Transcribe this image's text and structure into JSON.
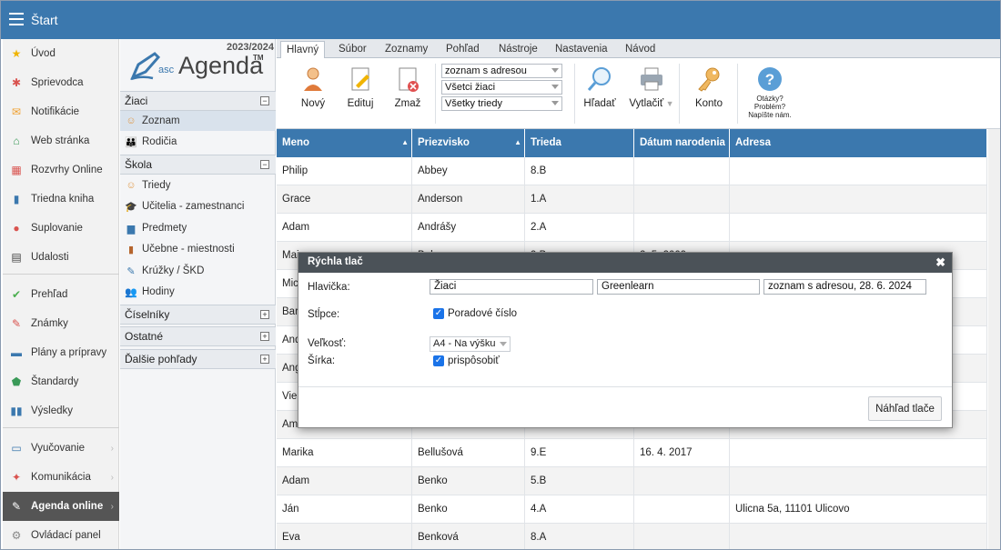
{
  "topbar": {
    "title": "Štart"
  },
  "leftnav": {
    "items": [
      {
        "label": "Úvod",
        "icon": "star-icon",
        "color": "#f0b400"
      },
      {
        "label": "Sprievodca",
        "icon": "wand-icon",
        "color": "#d9534f"
      },
      {
        "label": "Notifikácie",
        "icon": "envelope-icon",
        "color": "#f0a030"
      },
      {
        "label": "Web stránka",
        "icon": "house-icon",
        "color": "#3a9a58"
      },
      {
        "label": "Rozvrhy Online",
        "icon": "timetable-icon",
        "color": "#d9534f"
      },
      {
        "label": "Triedna kniha",
        "icon": "book-icon",
        "color": "#3b78ae"
      },
      {
        "label": "Suplovanie",
        "icon": "person-icon",
        "color": "#d9534f"
      },
      {
        "label": "Udalosti",
        "icon": "calendar-icon",
        "color": "#444"
      },
      {
        "label": "Prehľad",
        "icon": "check-circle-icon",
        "color": "#4caf50"
      },
      {
        "label": "Známky",
        "icon": "grade-icon",
        "color": "#d9534f"
      },
      {
        "label": "Plány a prípravy",
        "icon": "briefcase-icon",
        "color": "#3b78ae"
      },
      {
        "label": "Štandardy",
        "icon": "shield-icon",
        "color": "#3a9a58"
      },
      {
        "label": "Výsledky",
        "icon": "bar-chart-icon",
        "color": "#3b78ae"
      },
      {
        "label": "Vyučovanie",
        "icon": "open-book-icon",
        "color": "#3b78ae"
      },
      {
        "label": "Komunikácia",
        "icon": "chat-icon",
        "color": "#d9534f"
      },
      {
        "label": "Agenda online",
        "icon": "agenda-pen-icon",
        "color": "#ffffff"
      },
      {
        "label": "Ovládací panel",
        "icon": "gear-icon",
        "color": "#888"
      }
    ]
  },
  "logo": {
    "year": "2023/2024",
    "asc": "asc",
    "name": "Agenda",
    "tm": "TM"
  },
  "tree": {
    "sec_ziaci": "Žiaci",
    "zoznam": "Zoznam",
    "rodicia": "Rodičia",
    "sec_skola": "Škola",
    "triedy": "Triedy",
    "ucitelia": "Učitelia - zamestnanci",
    "predmety": "Predmety",
    "ucebne": "Učebne - miestnosti",
    "kruzky": "Krúžky / ŠKD",
    "hodiny": "Hodiny",
    "sec_ciselniky": "Číselníky",
    "sec_ostatne": "Ostatné",
    "sec_dalsie": "Ďalšie pohľady",
    "collapse_sym": "−",
    "expand_sym": "+"
  },
  "tabs": [
    "Hlavný",
    "Súbor",
    "Zoznamy",
    "Pohľad",
    "Nástroje",
    "Nastavenia",
    "Návod"
  ],
  "ribbon": {
    "novy": "Nový",
    "edituj": "Edituj",
    "zmaz": "Zmaž",
    "select1": "zoznam s adresou",
    "select2": "Všetci žiaci",
    "select3": "Všetky triedy",
    "hladat": "Hľadať",
    "vytlacit": "Vytlačiť",
    "konto": "Konto",
    "help_line1": "Otázky?",
    "help_line2": "Problém?",
    "help_line3": "Napíšte nám."
  },
  "grid": {
    "headers": [
      "Meno",
      "Priezvisko",
      "Trieda",
      "Dátum narodenia",
      "Adresa"
    ],
    "sort_arrow": "▲",
    "rows": [
      [
        "Philip",
        "Abbey",
        "8.B",
        "",
        ""
      ],
      [
        "Grace",
        "Anderson",
        "1.A",
        "",
        ""
      ],
      [
        "Adam",
        "Andrášy",
        "2.A",
        "",
        ""
      ],
      [
        "Mai",
        "Bel",
        "9.B",
        "2. 5. 2009",
        ""
      ],
      [
        "Mic",
        "",
        "",
        "",
        ""
      ],
      [
        "Bar",
        "",
        "",
        "",
        ""
      ],
      [
        "And",
        "",
        "",
        "",
        ""
      ],
      [
        "Ang",
        "",
        "",
        "",
        ""
      ],
      [
        "Vie",
        "",
        "",
        "",
        ""
      ],
      [
        "Am",
        "",
        "",
        "",
        ""
      ],
      [
        "Marika",
        "Bellušová",
        "9.E",
        "16. 4. 2017",
        ""
      ],
      [
        "Adam",
        "Benko",
        "5.B",
        "",
        ""
      ],
      [
        "Ján",
        "Benko",
        "4.A",
        "",
        "Ulicna 5a, 11101 Ulicovo"
      ],
      [
        "Eva",
        "Benková",
        "8.A",
        "",
        ""
      ]
    ]
  },
  "dialog": {
    "title": "Rýchla tlač",
    "close": "✖",
    "hlavicka_label": "Hlavička:",
    "hlavicka_1": "Žiaci",
    "hlavicka_2": "Greenlearn",
    "hlavicka_3": "zoznam s adresou, 28. 6. 2024",
    "stlpce_label": "Stĺpce:",
    "poradove": "Poradové číslo",
    "velkost_label": "Veľkosť:",
    "velkost_value": "A4 - Na výšku",
    "sirka_label": "Šírka:",
    "prisposobit": "prispôsobiť",
    "preview_button": "Náhľad tlače"
  }
}
